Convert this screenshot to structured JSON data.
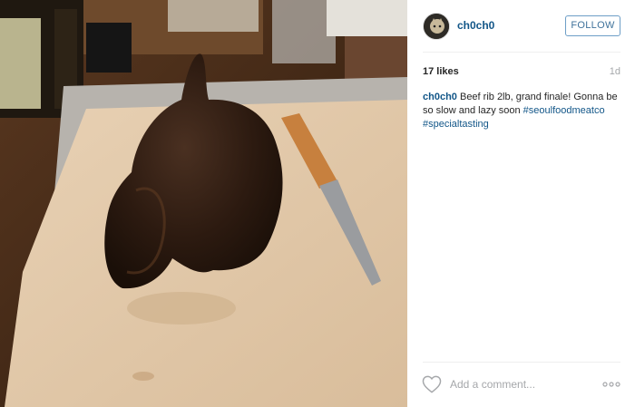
{
  "post": {
    "username": "ch0ch0",
    "follow_label": "FOLLOW",
    "likes": "17 likes",
    "age": "1d",
    "caption": {
      "user": "ch0ch0",
      "text": " Beef rib 2lb, grand finale! Gonna be so slow and lazy soon ",
      "tags": [
        "#seoulfoodmeatco",
        "#specialtasting"
      ]
    },
    "comment_placeholder": "Add a comment...",
    "icons": {
      "like": "heart-icon",
      "more": "more-options-icon"
    },
    "colors": {
      "link": "#125688",
      "follow_border": "#6d9ec7",
      "follow_text": "#3f729b",
      "muted": "#a5a7aa"
    }
  }
}
